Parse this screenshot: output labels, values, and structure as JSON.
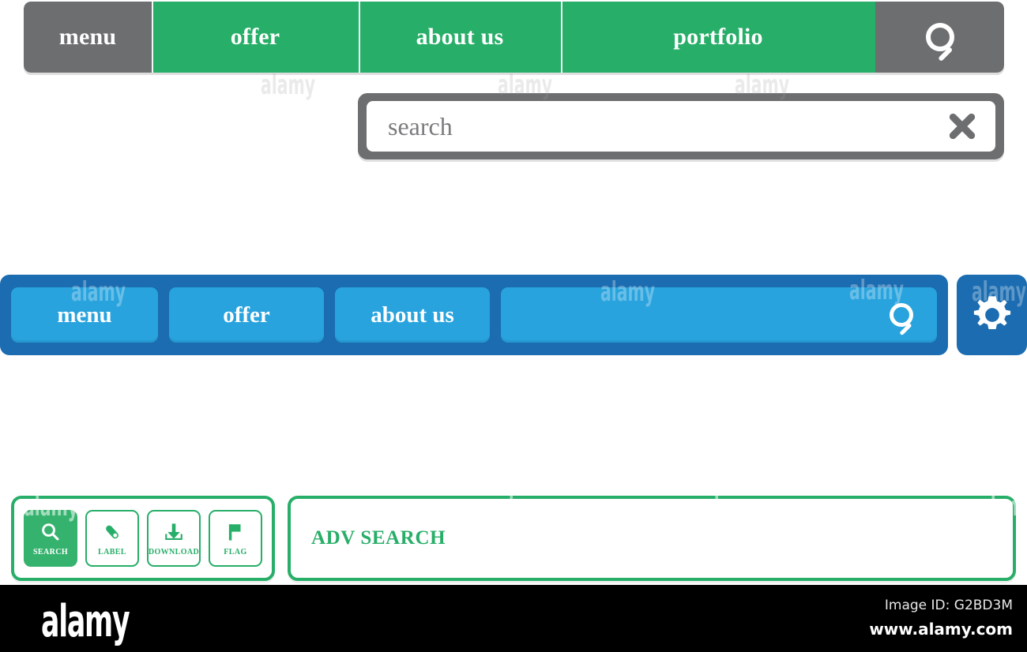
{
  "green_nav": {
    "tabs": [
      {
        "label": "menu",
        "style": "gray"
      },
      {
        "label": "offer",
        "style": "green"
      },
      {
        "label": "about us",
        "style": "green"
      },
      {
        "label": "portfolio",
        "style": "green"
      }
    ],
    "search_icon": "search-icon",
    "colors": {
      "accent": "#27ae68",
      "inactive": "#6d6e70",
      "text": "#ffffff"
    }
  },
  "search_box": {
    "value": "",
    "placeholder": "search",
    "clear_icon": "close-icon",
    "colors": {
      "frame": "#6d6e70",
      "field": "#ffffff",
      "text": "#6d6e70"
    }
  },
  "blue_nav": {
    "buttons": [
      {
        "label": "menu"
      },
      {
        "label": "offer"
      },
      {
        "label": "about us"
      }
    ],
    "search_field": {
      "value": "",
      "placeholder": "",
      "icon": "search-icon"
    },
    "settings_icon": "gear-icon",
    "colors": {
      "bar": "#1b6cb0",
      "button": "#28a3dd",
      "text": "#ffffff"
    }
  },
  "tool_panel": {
    "buttons": [
      {
        "label": "SEARCH",
        "icon": "search-icon",
        "active": true
      },
      {
        "label": "LABEL",
        "icon": "label-icon",
        "active": false
      },
      {
        "label": "DOWNLOAD",
        "icon": "download-icon",
        "active": false
      },
      {
        "label": "FLAG",
        "icon": "flag-icon",
        "active": false
      }
    ],
    "adv_search_label": "ADV SEARCH",
    "colors": {
      "accent": "#27ae68",
      "fill": "#35b36e",
      "panel": "#ffffff"
    }
  },
  "watermark": {
    "logo": "alamy",
    "image_id": "Image ID: G2BD3M",
    "url": "www.alamy.com",
    "tile_text": "alamy"
  }
}
